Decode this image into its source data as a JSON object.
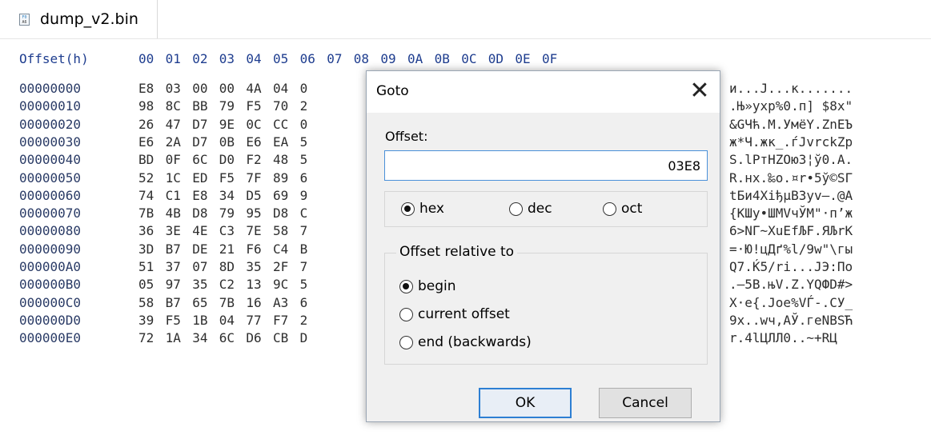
{
  "tab": {
    "icon_text_1": "F0",
    "icon_text_2": "A6",
    "label": "dump_v2.bin"
  },
  "hex_view": {
    "offset_header": "Offset(h)",
    "column_headers": [
      "00",
      "01",
      "02",
      "03",
      "04",
      "05",
      "06",
      "07",
      "08",
      "09",
      "0A",
      "0B",
      "0C",
      "0D",
      "0E",
      "0F"
    ],
    "rows": [
      {
        "offset": "00000000",
        "bytes": [
          "E8",
          "03",
          "00",
          "00",
          "4A",
          "04",
          "0"
        ],
        "ascii": "и...J...к......."
      },
      {
        "offset": "00000010",
        "bytes": [
          "98",
          "8C",
          "BB",
          "79",
          "F5",
          "70",
          "2"
        ],
        "ascii": ".Њ»yхр%0.п] $8х\""
      },
      {
        "offset": "00000020",
        "bytes": [
          "26",
          "47",
          "D7",
          "9E",
          "0C",
          "CC",
          "0"
        ],
        "ascii": "&GЧћ.М.УмёY.ZnЕЪ"
      },
      {
        "offset": "00000030",
        "bytes": [
          "E6",
          "2A",
          "D7",
          "0B",
          "E6",
          "EA",
          "5"
        ],
        "ascii": "ж*Ч.жк_.ѓJvrckZp"
      },
      {
        "offset": "00000040",
        "bytes": [
          "BD",
          "0F",
          "6C",
          "D0",
          "F2",
          "48",
          "5"
        ],
        "ascii": "S.lРтHZОю3¦ў0.A."
      },
      {
        "offset": "00000050",
        "bytes": [
          "52",
          "1C",
          "ED",
          "F5",
          "7F",
          "89",
          "6"
        ],
        "ascii": "R.нх.‰о.¤r•5ў©SГ"
      },
      {
        "offset": "00000060",
        "bytes": [
          "74",
          "C1",
          "E8",
          "34",
          "D5",
          "69",
          "9"
        ],
        "ascii": "tБи4ХiђµВЗyv—.@A"
      },
      {
        "offset": "00000070",
        "bytes": [
          "7B",
          "4B",
          "D8",
          "79",
          "95",
          "D8",
          "C"
        ],
        "ascii": "{КШу•ШМVчЎМ\"·п’ж"
      },
      {
        "offset": "00000080",
        "bytes": [
          "36",
          "3E",
          "4E",
          "C3",
          "7E",
          "58",
          "7"
        ],
        "ascii": "6>NГ~ХuЕfЉF.ЯЉrК"
      },
      {
        "offset": "00000090",
        "bytes": [
          "3D",
          "B7",
          "DE",
          "21",
          "F6",
          "C4",
          "B"
        ],
        "ascii": "=·Ю!цДґ%l/9w\"\\гы"
      },
      {
        "offset": "000000A0",
        "bytes": [
          "51",
          "37",
          "07",
          "8D",
          "35",
          "2F",
          "7"
        ],
        "ascii": "Q7.Ќ5/ri...JЭ:По"
      },
      {
        "offset": "000000B0",
        "bytes": [
          "05",
          "97",
          "35",
          "C2",
          "13",
          "9C",
          "5"
        ],
        "ascii": ".—5В.њV.Z.YQФD#>"
      },
      {
        "offset": "000000C0",
        "bytes": [
          "58",
          "B7",
          "65",
          "7B",
          "16",
          "A3",
          "6"
        ],
        "ascii": "X·e{.Јое%VЃ-.СУ_"
      },
      {
        "offset": "000000D0",
        "bytes": [
          "39",
          "F5",
          "1B",
          "04",
          "77",
          "F7",
          "2"
        ],
        "ascii": "9х..wч,АЎ.геNBSЋ"
      },
      {
        "offset": "000000E0",
        "bytes": [
          "72",
          "1A",
          "34",
          "6C",
          "D6",
          "CB",
          "D"
        ],
        "ascii": "r.4lЦЛЛ0..~+RЦ"
      }
    ]
  },
  "dialog": {
    "title": "Goto",
    "close_glyph": "✕",
    "offset_label": "Offset:",
    "offset_value": "03E8",
    "base_options": [
      {
        "label": "hex",
        "selected": true
      },
      {
        "label": "dec",
        "selected": false
      },
      {
        "label": "oct",
        "selected": false
      }
    ],
    "relative_legend": "Offset relative to",
    "relative_options": [
      {
        "label": "begin",
        "selected": true
      },
      {
        "label": "current offset",
        "selected": false
      },
      {
        "label": "end (backwards)",
        "selected": false
      }
    ],
    "ok_label": "OK",
    "cancel_label": "Cancel"
  }
}
